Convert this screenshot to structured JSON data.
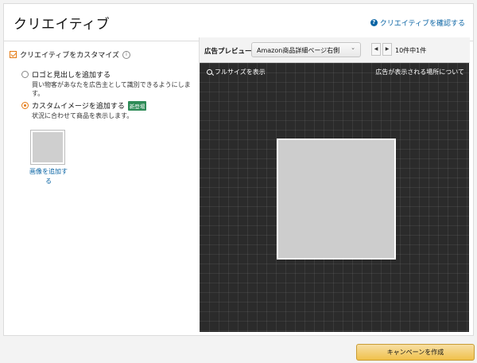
{
  "header": {
    "title": "クリエイティブ",
    "review_link": "クリエイティブを確認する"
  },
  "left_panel": {
    "customize_label": "クリエイティブをカスタマイズ",
    "options": [
      {
        "label": "ロゴと見出しを追加する",
        "description": "買い物客があなたを広告主として識別できるようにします。",
        "selected": false
      },
      {
        "label": "カスタムイメージを追加する",
        "badge": "新登場",
        "description": "状況に合わせて商品を表示します。",
        "selected": true
      }
    ],
    "add_image_label": "画像を追加する"
  },
  "preview": {
    "label": "広告プレビュー",
    "placement": "Amazon商品詳細ページ右側",
    "count": "10件中1件",
    "full_size": "フルサイズを表示",
    "where_link": "広告が表示される場所について"
  },
  "footer": {
    "create_button": "キャンペーンを作成"
  },
  "colors": {
    "accent": "#e47911",
    "link": "#0a64a4",
    "badge": "#2e8b57",
    "button": "#f0c14b",
    "preview_bg": "#2b2b2b"
  }
}
